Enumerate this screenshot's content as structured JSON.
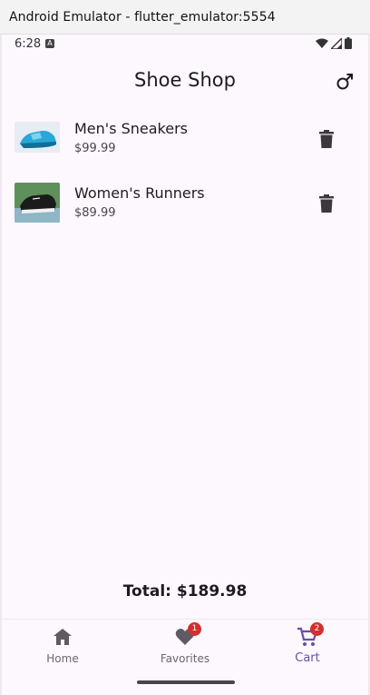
{
  "window": {
    "title": "Android Emulator - flutter_emulator:5554"
  },
  "status_bar": {
    "time": "6:28"
  },
  "app_bar": {
    "title": "Shoe Shop",
    "action_icon": "male-symbol-icon"
  },
  "cart": {
    "items": [
      {
        "name": "Men's Sneakers",
        "price": "$99.99",
        "thumb_color": "#2aa7d6"
      },
      {
        "name": "Women's Runners",
        "price": "$89.99",
        "thumb_color": "#1a1a1a"
      }
    ],
    "total": "Total: $189.98"
  },
  "nav": {
    "items": [
      {
        "label": "Home",
        "icon": "home-icon"
      },
      {
        "label": "Favorites",
        "icon": "heart-icon",
        "badge": "1"
      },
      {
        "label": "Cart",
        "icon": "cart-icon",
        "badge": "2",
        "active": true
      }
    ]
  },
  "colors": {
    "accent": "#6750a4",
    "badge": "#d32f2f",
    "background": "#fdf7fe"
  }
}
